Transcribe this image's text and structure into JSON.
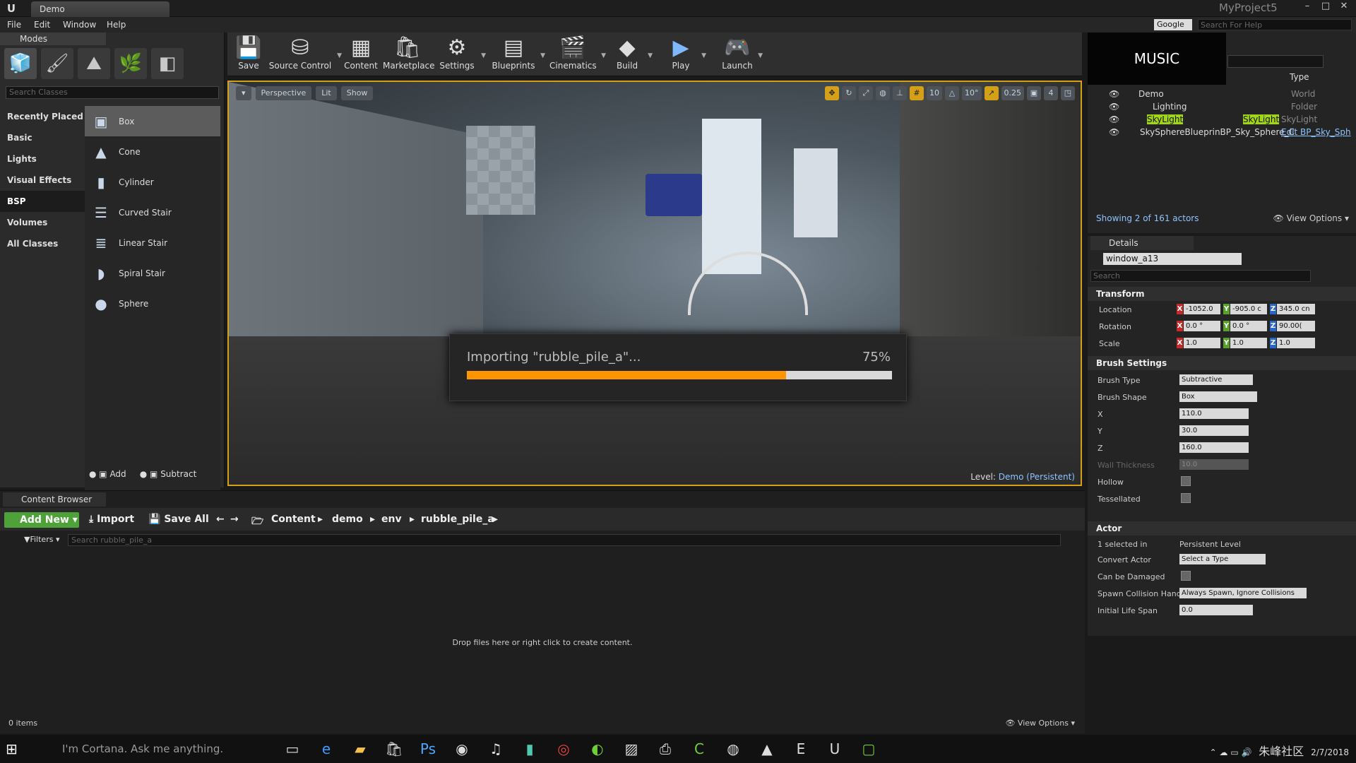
{
  "window": {
    "title": "Demo",
    "project": "MyProject5"
  },
  "menu": {
    "items": [
      "File",
      "Edit",
      "Window",
      "Help"
    ],
    "google": "Google",
    "help_placeholder": "Search For Help"
  },
  "modes": {
    "title": "Modes",
    "search_placeholder": "Search Classes",
    "categories": [
      "Recently Placed",
      "Basic",
      "Lights",
      "Visual Effects",
      "BSP",
      "Volumes",
      "All Classes"
    ],
    "items": [
      "Box",
      "Cone",
      "Cylinder",
      "Curved Stair",
      "Linear Stair",
      "Spiral Stair",
      "Sphere"
    ],
    "add_label": "Add",
    "subtract_label": "Subtract"
  },
  "toolbar": {
    "buttons": [
      "Save",
      "Source Control",
      "Content",
      "Marketplace",
      "Settings",
      "Blueprints",
      "Cinematics",
      "Build",
      "Play",
      "Launch"
    ]
  },
  "viewport": {
    "perspective": "Perspective",
    "lit": "Lit",
    "show": "Show",
    "grid_snap": "10",
    "rot_snap": "10°",
    "scale_snap": "0.25",
    "cam_speed": "4",
    "level_label": "Level:",
    "level_name": "Demo (Persistent)"
  },
  "import_dialog": {
    "message": "Importing \"rubble_pile_a\"...",
    "percent_text": "75%",
    "progress": 0.75
  },
  "content_browser": {
    "tab": "Content Browser",
    "add_new": "Add New",
    "import": "Import",
    "save_all": "Save All",
    "breadcrumb": [
      "Content",
      "demo",
      "env",
      "rubble_pile_a"
    ],
    "filters": "Filters",
    "search_placeholder": "Search rubble_pile_a",
    "empty_text": "Drop files here or right click to create content.",
    "item_count": "0 items",
    "view_options": "View Options"
  },
  "outliner": {
    "music_label": "MUSIC",
    "type_header": "Type",
    "rows": [
      {
        "name": "Demo",
        "type": "World"
      },
      {
        "name": "Lighting",
        "type": "Folder"
      },
      {
        "name": "SkyLight",
        "type": "SkyLight",
        "extra": "SkyLight"
      },
      {
        "name": "SkySphereBlueprinBP_Sky_Sphere_C",
        "type": "Edit BP_Sky_Sph"
      }
    ],
    "showing": "Showing 2 of 161 actors",
    "view_options": "View Options"
  },
  "details": {
    "tab": "Details",
    "actor_name": "window_a13",
    "search_placeholder": "Search",
    "transform": {
      "title": "Transform",
      "location_label": "Location",
      "rotation_label": "Rotation",
      "scale_label": "Scale",
      "location": [
        "-1052.0",
        "-905.0 c",
        "345.0 cn"
      ],
      "rotation": [
        "0.0 °",
        "0.0 °",
        "90.00("
      ],
      "scale": [
        "1.0",
        "1.0",
        "1.0"
      ]
    },
    "brush": {
      "title": "Brush Settings",
      "type_label": "Brush Type",
      "type_value": "Subtractive",
      "shape_label": "Brush Shape",
      "shape_value": "Box",
      "x_label": "X",
      "x_value": "110.0",
      "y_label": "Y",
      "y_value": "30.0",
      "z_label": "Z",
      "z_value": "160.0",
      "wall_label": "Wall Thickness",
      "wall_value": "10.0",
      "hollow_label": "Hollow",
      "tess_label": "Tessellated"
    },
    "actor": {
      "title": "Actor",
      "selected_label": "1 selected in",
      "selected_value": "Persistent Level",
      "convert_label": "Convert Actor",
      "convert_value": "Select a Type",
      "damaged_label": "Can be Damaged",
      "spawn_label": "Spawn Collision Hand",
      "spawn_value": "Always Spawn, Ignore Collisions",
      "life_label": "Initial Life Span",
      "life_value": "0.0"
    }
  },
  "taskbar": {
    "cortana": "I'm Cortana. Ask me anything.",
    "watermark": "朱峰社区",
    "time": "2/7/2018"
  }
}
